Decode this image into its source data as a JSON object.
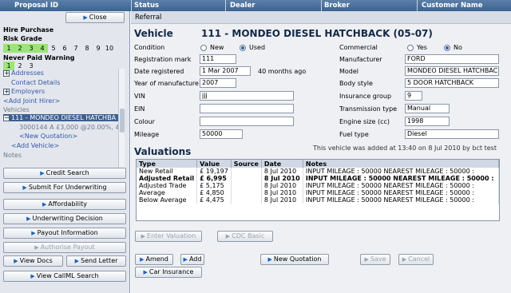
{
  "header": {
    "proposal_id": "Proposal ID",
    "status": "Status",
    "dealer": "Dealer",
    "broker": "Broker",
    "customer_name": "Customer Name"
  },
  "status_value": "Referral",
  "left": {
    "close_label": "Close",
    "hire_purchase": "Hire Purchase",
    "risk_grade": "Risk Grade",
    "risk_grades": [
      "1",
      "2",
      "3",
      "4",
      "5",
      "6",
      "7",
      "8",
      "9",
      "10"
    ],
    "risk_grade_selected": [
      "1",
      "2",
      "3",
      "4"
    ],
    "never_paid_warning": "Never Paid Warning",
    "warning_levels": [
      "1",
      "2",
      "3"
    ],
    "warning_selected": "1",
    "tree": {
      "addresses": "Addresses",
      "contact_details": "Contact Details",
      "employers": "Employers",
      "add_joint_hirer": "<Add Joint Hirer>",
      "vehicles": "Vehicles",
      "vehicle_item": "111 - MONDEO DIESEL HATCHBA",
      "quotation_item": "3000144 A £3,000 @20.00%, 4",
      "new_quotation": "<New Quotation>",
      "add_vehicle": "<Add Vehicle>",
      "notes": "Notes"
    },
    "buttons": {
      "credit_search": "Credit Search",
      "submit_underwriting": "Submit For Underwriting",
      "affordability": "Affordability",
      "underwriting_decision": "Underwriting Decision",
      "payout_information": "Payout Information",
      "authorise_payout": "Authorise Payout",
      "view_docs": "View Docs",
      "send_letter": "Send Letter",
      "view_callml": "View CallML Search"
    }
  },
  "vehicle": {
    "heading": "Vehicle",
    "title": "111 - MONDEO DIESEL HATCHBACK (05-07)",
    "labels": {
      "condition": "Condition",
      "new": "New",
      "used": "Used",
      "registration_mark": "Registration mark",
      "date_registered": "Date registered",
      "year_of_manufacture": "Year of manufacture",
      "vin": "VIN",
      "ein": "EIN",
      "colour": "Colour",
      "mileage": "Mileage",
      "commercial": "Commercial",
      "yes": "Yes",
      "no": "No",
      "manufacturer": "Manufacturer",
      "model": "Model",
      "body_style": "Body style",
      "insurance_group": "Insurance group",
      "transmission_type": "Transmission type",
      "engine_size": "Engine size (cc)",
      "fuel_type": "Fuel type"
    },
    "values": {
      "condition": "Used",
      "registration_mark": "111",
      "date_registered": "1 Mar 2007",
      "age_text": "40 months ago",
      "year_of_manufacture": "2007",
      "vin": "jjj",
      "ein": "",
      "colour": "",
      "mileage": "50000",
      "commercial": "No",
      "manufacturer": "FORD",
      "model": "MONDEO DIESEL HATCHBAC",
      "body_style": "5 DOOR HATCHBACK",
      "insurance_group": "9",
      "transmission_type": "Manual",
      "engine_size": "1998",
      "fuel_type": "Diesel"
    }
  },
  "valuations": {
    "heading": "Valuations",
    "added_note": "This vehicle was added at 13:40 on 8 Jul 2010  by bct test",
    "columns": [
      "Type",
      "Value",
      "Source",
      "Date",
      "Notes"
    ],
    "rows": [
      {
        "type": "New Retail",
        "value": "£ 19,197",
        "source": "",
        "date": "8 Jul 2010",
        "notes": "INPUT MILEAGE : 50000 NEAREST MILEAGE : 50000 :",
        "bold": false
      },
      {
        "type": "Adjusted Retail",
        "value": "£ 6,995",
        "source": "",
        "date": "8 Jul 2010",
        "notes": "INPUT MILEAGE : 50000 NEAREST MILEAGE : 50000 :",
        "bold": true
      },
      {
        "type": "Adjusted Trade",
        "value": "£ 5,175",
        "source": "",
        "date": "8 Jul 2010",
        "notes": "INPUT MILEAGE : 50000 NEAREST MILEAGE : 50000 :",
        "bold": false
      },
      {
        "type": "Average",
        "value": "£ 4,850",
        "source": "",
        "date": "8 Jul 2010",
        "notes": "INPUT MILEAGE : 50000 NEAREST MILEAGE : 50000 :",
        "bold": false
      },
      {
        "type": "Below Average",
        "value": "£ 4,475",
        "source": "",
        "date": "8 Jul 2010",
        "notes": "INPUT MILEAGE : 50000 NEAREST MILEAGE : 50000 :",
        "bold": false
      }
    ],
    "enter_valuation": "Enter Valuation",
    "cdc_basic": "CDC Basic"
  },
  "actions": {
    "amend": "Amend",
    "add": "Add",
    "new_quotation": "New Quotation",
    "save": "Save",
    "cancel": "Cancel",
    "car_insurance": "Car Insurance"
  },
  "colors": {
    "header_bg": "#4a70a0",
    "selection": "#3d5f91",
    "grade_on": "#9be37a",
    "button_arrow": "#1f5fb5"
  }
}
